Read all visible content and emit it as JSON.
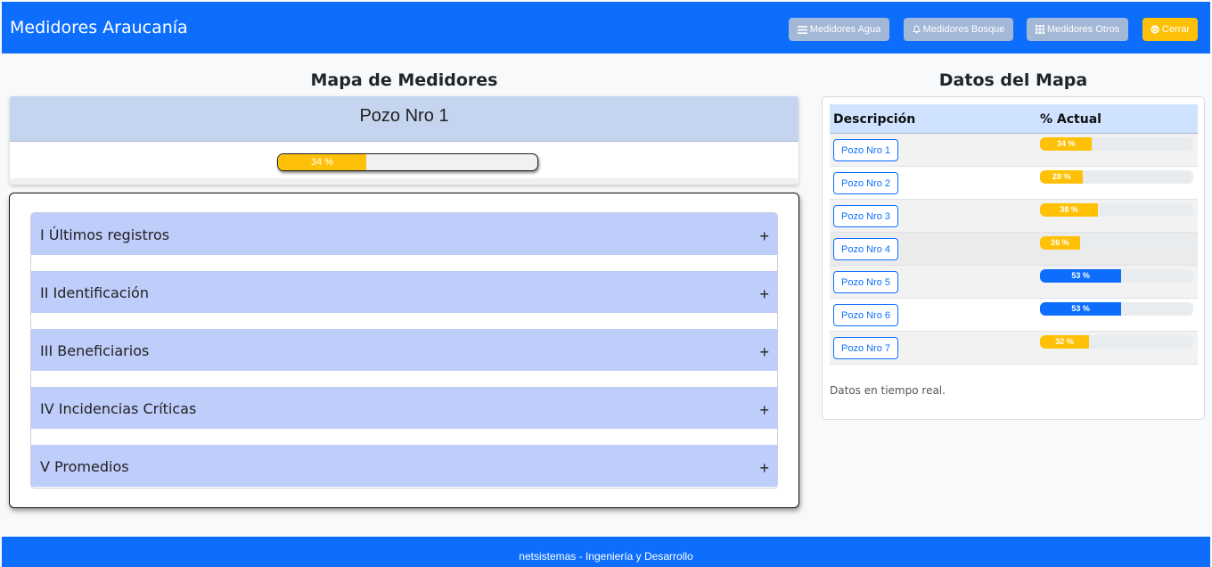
{
  "navbar": {
    "brand": "Medidores Araucanía",
    "buttons": [
      {
        "label": "Medidores Agua",
        "icon": "water-icon"
      },
      {
        "label": "Medidores Bosque",
        "icon": "bell-icon"
      },
      {
        "label": "Medidores Otros",
        "icon": "grid-icon"
      },
      {
        "label": "Cerrar",
        "icon": "power-icon"
      }
    ]
  },
  "map": {
    "title": "Mapa de Medidores",
    "pozo_title": "Pozo Nro 1",
    "progress_label": "34 %",
    "progress_fraction": 0.34,
    "accordion": [
      {
        "label": "I Últimos registros",
        "toggle": "+"
      },
      {
        "label": "II Identificación",
        "toggle": "+"
      },
      {
        "label": "III Beneficiarios",
        "toggle": "+"
      },
      {
        "label": "IV Incidencias Críticas",
        "toggle": "+"
      },
      {
        "label": "V Promedios",
        "toggle": "+"
      }
    ]
  },
  "datos": {
    "title": "Datos del Mapa",
    "headers": [
      "Descripción",
      "% Actual"
    ],
    "rows": [
      {
        "name": "Pozo Nro 1",
        "label": "34 %",
        "fraction": 0.34,
        "color": "#ffc107"
      },
      {
        "name": "Pozo Nro 2",
        "label": "28 %",
        "fraction": 0.28,
        "color": "#ffc107"
      },
      {
        "name": "Pozo Nro 3",
        "label": "38 %",
        "fraction": 0.38,
        "color": "#ffc107"
      },
      {
        "name": "Pozo Nro 4",
        "label": "26 %",
        "fraction": 0.26,
        "color": "#ffc107"
      },
      {
        "name": "Pozo Nro 5",
        "label": "53 %",
        "fraction": 0.53,
        "color": "#0d6efd"
      },
      {
        "name": "Pozo Nro 6",
        "label": "53 %",
        "fraction": 0.53,
        "color": "#0d6efd"
      },
      {
        "name": "Pozo Nro 7",
        "label": "32 %",
        "fraction": 0.32,
        "color": "#ffc107"
      }
    ],
    "note": "Datos en tiempo real."
  },
  "footer": {
    "text": "netsistemas - Ingeniería y Desarrollo"
  },
  "colors": {
    "primary": "#0d6efd",
    "warning": "#ffc107",
    "header_bg": "#c5d5f0",
    "accordion_bg": "#bfcdfb"
  }
}
